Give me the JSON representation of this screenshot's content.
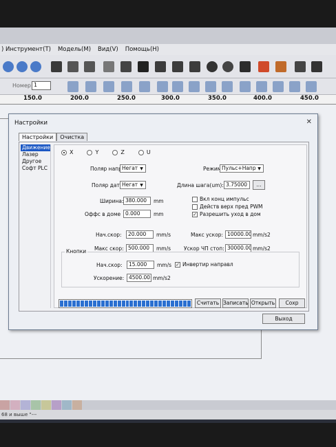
{
  "menu": [
    ") Инструмент(T)",
    "Модель(M)",
    "Вид(V)",
    "Помощь(H)"
  ],
  "toolbar": {
    "number_label": "Номер:",
    "number_value": "1"
  },
  "ruler": [
    "150.0",
    "200.0",
    "250.0",
    "300.0",
    "350.0",
    "400.0",
    "450.0"
  ],
  "statusbar": {
    "text": "68 и выше \"---"
  },
  "dialog": {
    "title": "Настройки",
    "tabs": [
      "Настройки",
      "Очистка"
    ],
    "categories": [
      "Движение",
      "Лазер",
      "Другое",
      "Софт PLC"
    ],
    "axes": [
      "X",
      "Y",
      "Z",
      "U"
    ],
    "polar_dir_label": "Поляр напр",
    "polar_dir_value": "Негат",
    "polar_sensor_label": "Поляр датч",
    "polar_sensor_value": "Негат",
    "mode_label": "Режим",
    "mode_value": "Пульс+Напр",
    "step_label": "Длина шага(um):",
    "step_value": "3.75000",
    "step_btn": "...",
    "width_label": "Ширина:",
    "width_value": "380.000",
    "width_unit": "mm",
    "home_offset_label": "Оффс в доме",
    "home_offset_value": "0.000",
    "home_offset_unit": "mm",
    "chk_limit": "Вкл конц импульс",
    "chk_pwm": "Действ верх пред PWM",
    "chk_home": "Разрешить уход в дом",
    "start_speed_label": "Нач.скор:",
    "start_speed_value": "20.000",
    "speed_unit": "mm/s",
    "max_speed_label": "Макс скор:",
    "max_speed_value": "500.000",
    "max_accel_label": "Макс ускор:",
    "max_accel_value": "10000.00",
    "accel_unit": "mm/s2",
    "estop_accel_label": "Ускор ЧП стоп:",
    "estop_accel_value": "30000.00",
    "keys_group": "Кнопки",
    "key_start_speed_label": "Нач.скор:",
    "key_start_speed_value": "15.000",
    "invert_dir": "Инвертир направл",
    "key_accel_label": "Ускорение:",
    "key_accel_value": "4500.00",
    "btn_read": "Считать",
    "btn_write": "Записать",
    "btn_open": "Открыть",
    "btn_save": "Сохр",
    "btn_exit": "Выход",
    "progress": 1.0
  },
  "colors": {
    "selection": "#1c58c4",
    "progress": "#2a6fd0"
  }
}
